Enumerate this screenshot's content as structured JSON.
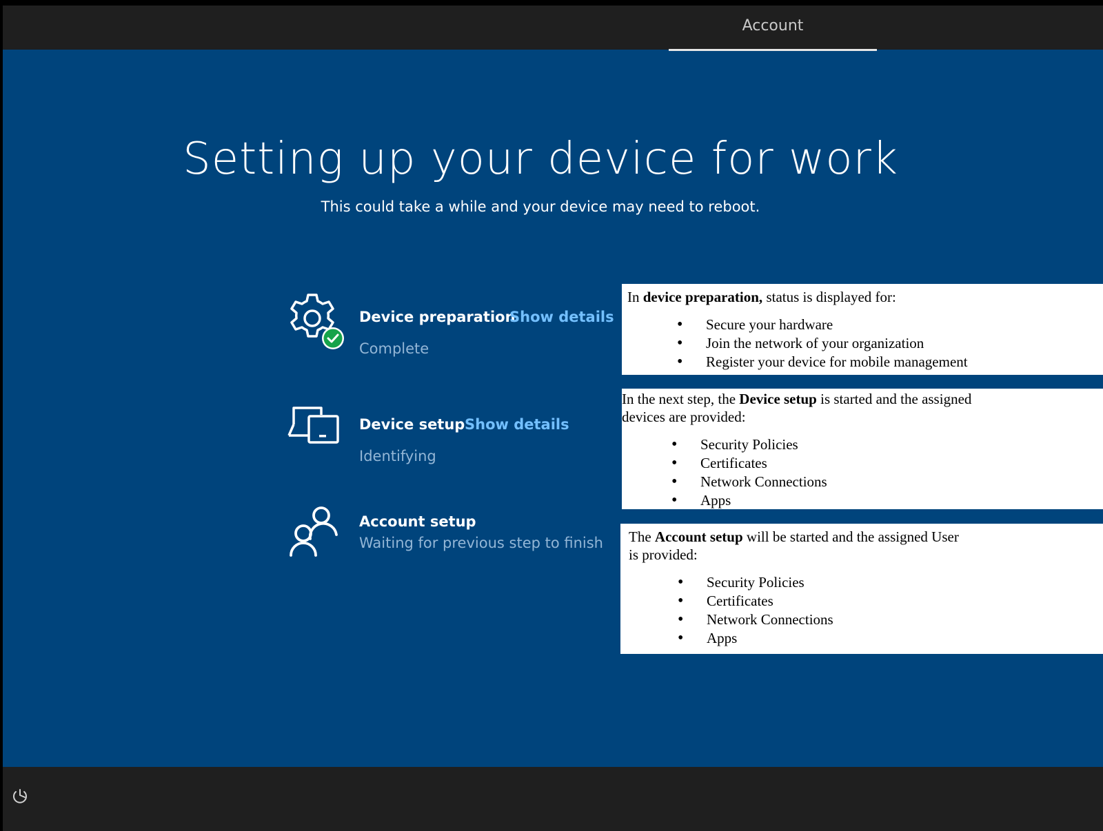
{
  "header": {
    "tab_label": "Account"
  },
  "main": {
    "title": "Setting up your device for work",
    "subtitle": "This could take a while and your device may need to reboot.",
    "steps": [
      {
        "title": "Device preparation",
        "link": "Show details",
        "status": "Complete",
        "icon": "gear-check-icon"
      },
      {
        "title": "Device setup",
        "link": "Show details",
        "status": "Identifying",
        "icon": "devices-icon"
      },
      {
        "title": "Account setup",
        "status": "Waiting for previous step to finish",
        "icon": "people-icon"
      }
    ]
  },
  "notes": [
    {
      "intro_pre": "In ",
      "intro_bold": "device preparation,",
      "intro_post": " status is displayed for:",
      "items": [
        "Secure your hardware",
        "Join the network of your organization",
        "Register your device for mobile management"
      ]
    },
    {
      "intro_pre": "In the next step, the ",
      "intro_bold": "Device setup",
      "intro_post": " is started and the assigned",
      "intro_line2": "devices are provided:",
      "items": [
        "Security Policies",
        "Certificates",
        "Network Connections",
        "Apps"
      ]
    },
    {
      "intro_pre": "The ",
      "intro_bold": "Account setup",
      "intro_post": " will be started and the assigned User",
      "intro_line2": "is provided:",
      "items": [
        "Security Policies",
        "Certificates",
        "Network Connections",
        "Apps"
      ]
    }
  ],
  "footer": {
    "icon": "ease-of-access-icon"
  },
  "colors": {
    "background": "#00447c",
    "bar": "#1f1f1f",
    "link": "#74c0ff",
    "status": "#93b6d6",
    "success": "#16a34a"
  }
}
